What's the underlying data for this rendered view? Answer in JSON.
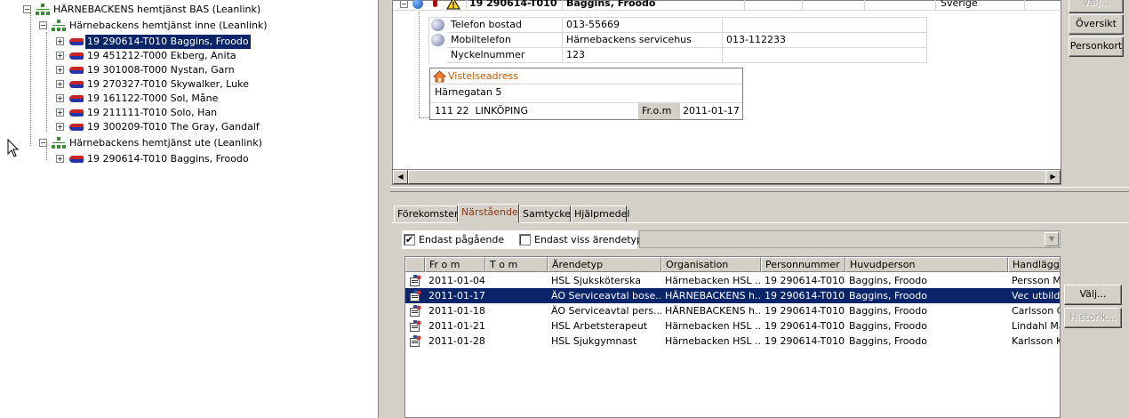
{
  "tree": {
    "root": "HÄRNEBACKENS hemtjänst BAS (Leanlink)",
    "group1": "Härnebackens hemtjänst inne (Leanlink)",
    "group1_items": [
      "19 290614-T010 Baggins, Froodo",
      "19 451212-T000 Ekberg, Anita",
      "19 301008-T000 Nystan, Garn",
      "19 270327-T010 Skywalker, Luke",
      "19 161122-T000 Sol, Måne",
      "19 211111-T010 Solo, Han",
      "19 300209-T010 The Gray, Gandalf"
    ],
    "group2": "Härnebackens hemtjänst ute (Leanlink)",
    "group2_items": [
      "19 290614-T010 Baggins, Froodo"
    ]
  },
  "person": {
    "pnr": "19 290614-T010",
    "name": "Baggins, Froodo",
    "country": "Sverige",
    "contacts": [
      {
        "label": "Telefon bostad",
        "value": "013-55669",
        "extra": ""
      },
      {
        "label": "Mobiltelefon",
        "value": "Härnebackens servicehus",
        "extra": "013-112233"
      },
      {
        "label": "Nyckelnummer",
        "value": "123",
        "extra": ""
      }
    ],
    "address": {
      "title": "Vistelseadress",
      "street": "Härnegatan 5",
      "postal": "111 22  LINKÖPING",
      "from_label": "Fr.o.m",
      "from_value": "2011-01-17"
    }
  },
  "side_buttons": {
    "valj_top": "Välj...",
    "oversikt": "Översikt",
    "personkort": "Personkort"
  },
  "tabs": [
    "Förekomster",
    "Närstående",
    "Samtycke",
    "Hjälpmedel"
  ],
  "filters": {
    "only_ongoing": "Endast pågående",
    "only_ongoing_checked": "✔",
    "only_type": "Endast viss ärendetyp"
  },
  "grid": {
    "headers": [
      "Fr o m",
      "T o m",
      "Ärendetyp",
      "Organisation",
      "Personnummer",
      "Huvudperson",
      "Handläggar"
    ],
    "rows": [
      [
        "2011-01-04",
        "",
        "HSL Sjuksköterska",
        "Härnebacken HSL ...",
        "19 290614-T010",
        "Baggins, Froodo",
        "Persson Ma"
      ],
      [
        "2011-01-17",
        "",
        "ÄO Serviceavtal bose...",
        "HÄRNEBACKENS h...",
        "19 290614-T010",
        "Baggins, Froodo",
        "Vec utbildar"
      ],
      [
        "2011-01-18",
        "",
        "ÄO Serviceavtal pers...",
        "HÄRNEBACKENS h...",
        "19 290614-T010",
        "Baggins, Froodo",
        "Carlsson Ca"
      ],
      [
        "2011-01-21",
        "",
        "HSL Arbetsterapeut",
        "Härnebacken HSL ...",
        "19 290614-T010",
        "Baggins, Froodo",
        "Lindahl Mar"
      ],
      [
        "2011-01-28",
        "",
        "HSL Sjukgymnast",
        "Härnebacken HSL ...",
        "19 290614-T010",
        "Baggins, Froodo",
        "Karlsson Ka"
      ]
    ],
    "selected_row": 1
  },
  "grid_buttons": {
    "valj": "Välj...",
    "historik": "Historik..."
  },
  "colors": {
    "selection": "#0a246a",
    "tab_active": "#8b3a0e",
    "address_title": "#c85a00"
  }
}
